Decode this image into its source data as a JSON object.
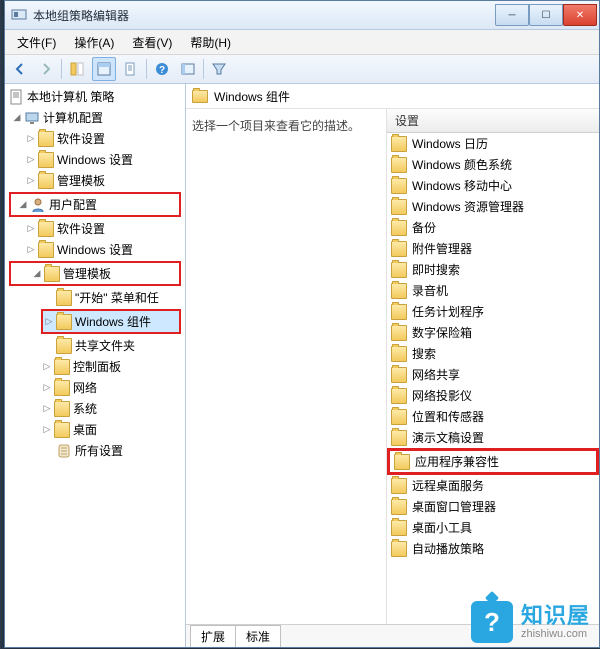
{
  "title": "本地组策略编辑器",
  "menubar": [
    "文件(F)",
    "操作(A)",
    "查看(V)",
    "帮助(H)"
  ],
  "tree": {
    "root": "本地计算机 策略",
    "computer": "计算机配置",
    "comp_software": "软件设置",
    "comp_win": "Windows 设置",
    "comp_admin": "管理模板",
    "user": "用户配置",
    "user_software": "软件设置",
    "user_win": "Windows 设置",
    "user_admin": "管理模板",
    "startmenu": "\"开始\" 菜单和任",
    "win_components": "Windows 组件",
    "shared": "共享文件夹",
    "cpl": "控制面板",
    "network": "网络",
    "system": "系统",
    "desktop": "桌面",
    "all": "所有设置"
  },
  "right_header": "Windows 组件",
  "desc": "选择一个项目来查看它的描述。",
  "settings_header": "设置",
  "settings": [
    "Windows 日历",
    "Windows 颜色系统",
    "Windows 移动中心",
    "Windows 资源管理器",
    "备份",
    "附件管理器",
    "即时搜索",
    "录音机",
    "任务计划程序",
    "数字保险箱",
    "搜索",
    "网络共享",
    "网络投影仪",
    "位置和传感器",
    "演示文稿设置",
    "应用程序兼容性",
    "远程桌面服务",
    "桌面窗口管理器",
    "桌面小工具",
    "自动播放策略"
  ],
  "highlight_index": 15,
  "tabs": [
    "扩展",
    "标准"
  ],
  "watermark": {
    "brand": "知识屋",
    "url": "zhishiwu.com"
  }
}
